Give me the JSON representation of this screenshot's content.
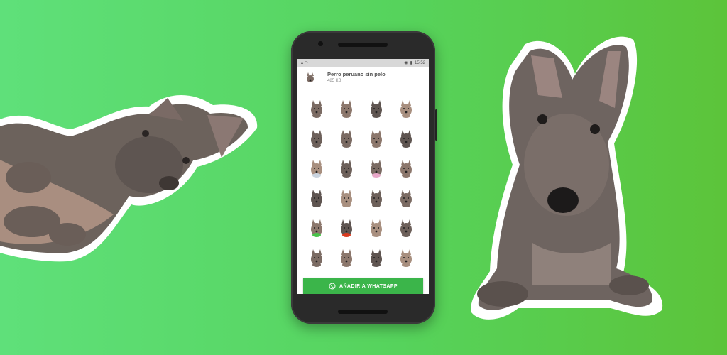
{
  "status_bar": {
    "time": "15:52",
    "battery_icon": "battery-icon",
    "signal_icon": "signal-icon",
    "wifi_icon": "wifi-icon"
  },
  "pack": {
    "title": "Perro peruano sin pelo",
    "size": "485 KB",
    "icon": "dog-sticker-icon"
  },
  "stickers": [
    "dog-head-tilt",
    "dog-head-side",
    "dog-lying-head",
    "dog-puppy-ears",
    "dog-sitting-small",
    "dog-lying-tan",
    "dog-puppy-tan",
    "dog-standing-tan",
    "dog-grey-sweater",
    "dog-standing",
    "dog-pink-sweater",
    "dog-sitting-dark",
    "dog-standing-ears",
    "dog-sitting-front",
    "dog-sitting-back",
    "dog-profile",
    "dog-green-collar",
    "dog-red-scarf",
    "dog-closeup",
    "dog-lying-side",
    "dog-sitting-left",
    "dog-sitting-right",
    "dog-running",
    "dog-stretching"
  ],
  "add_button": {
    "label": "AÑADIR A WHATSAPP",
    "icon": "whatsapp-icon"
  },
  "colors": {
    "background": "#5bd65a",
    "button": "#3bb54a",
    "phone_body": "#2a2a2a"
  },
  "decorations": {
    "left_art": "hairless-dog-lying-sticker",
    "right_art": "hairless-dog-sitting-sticker"
  }
}
